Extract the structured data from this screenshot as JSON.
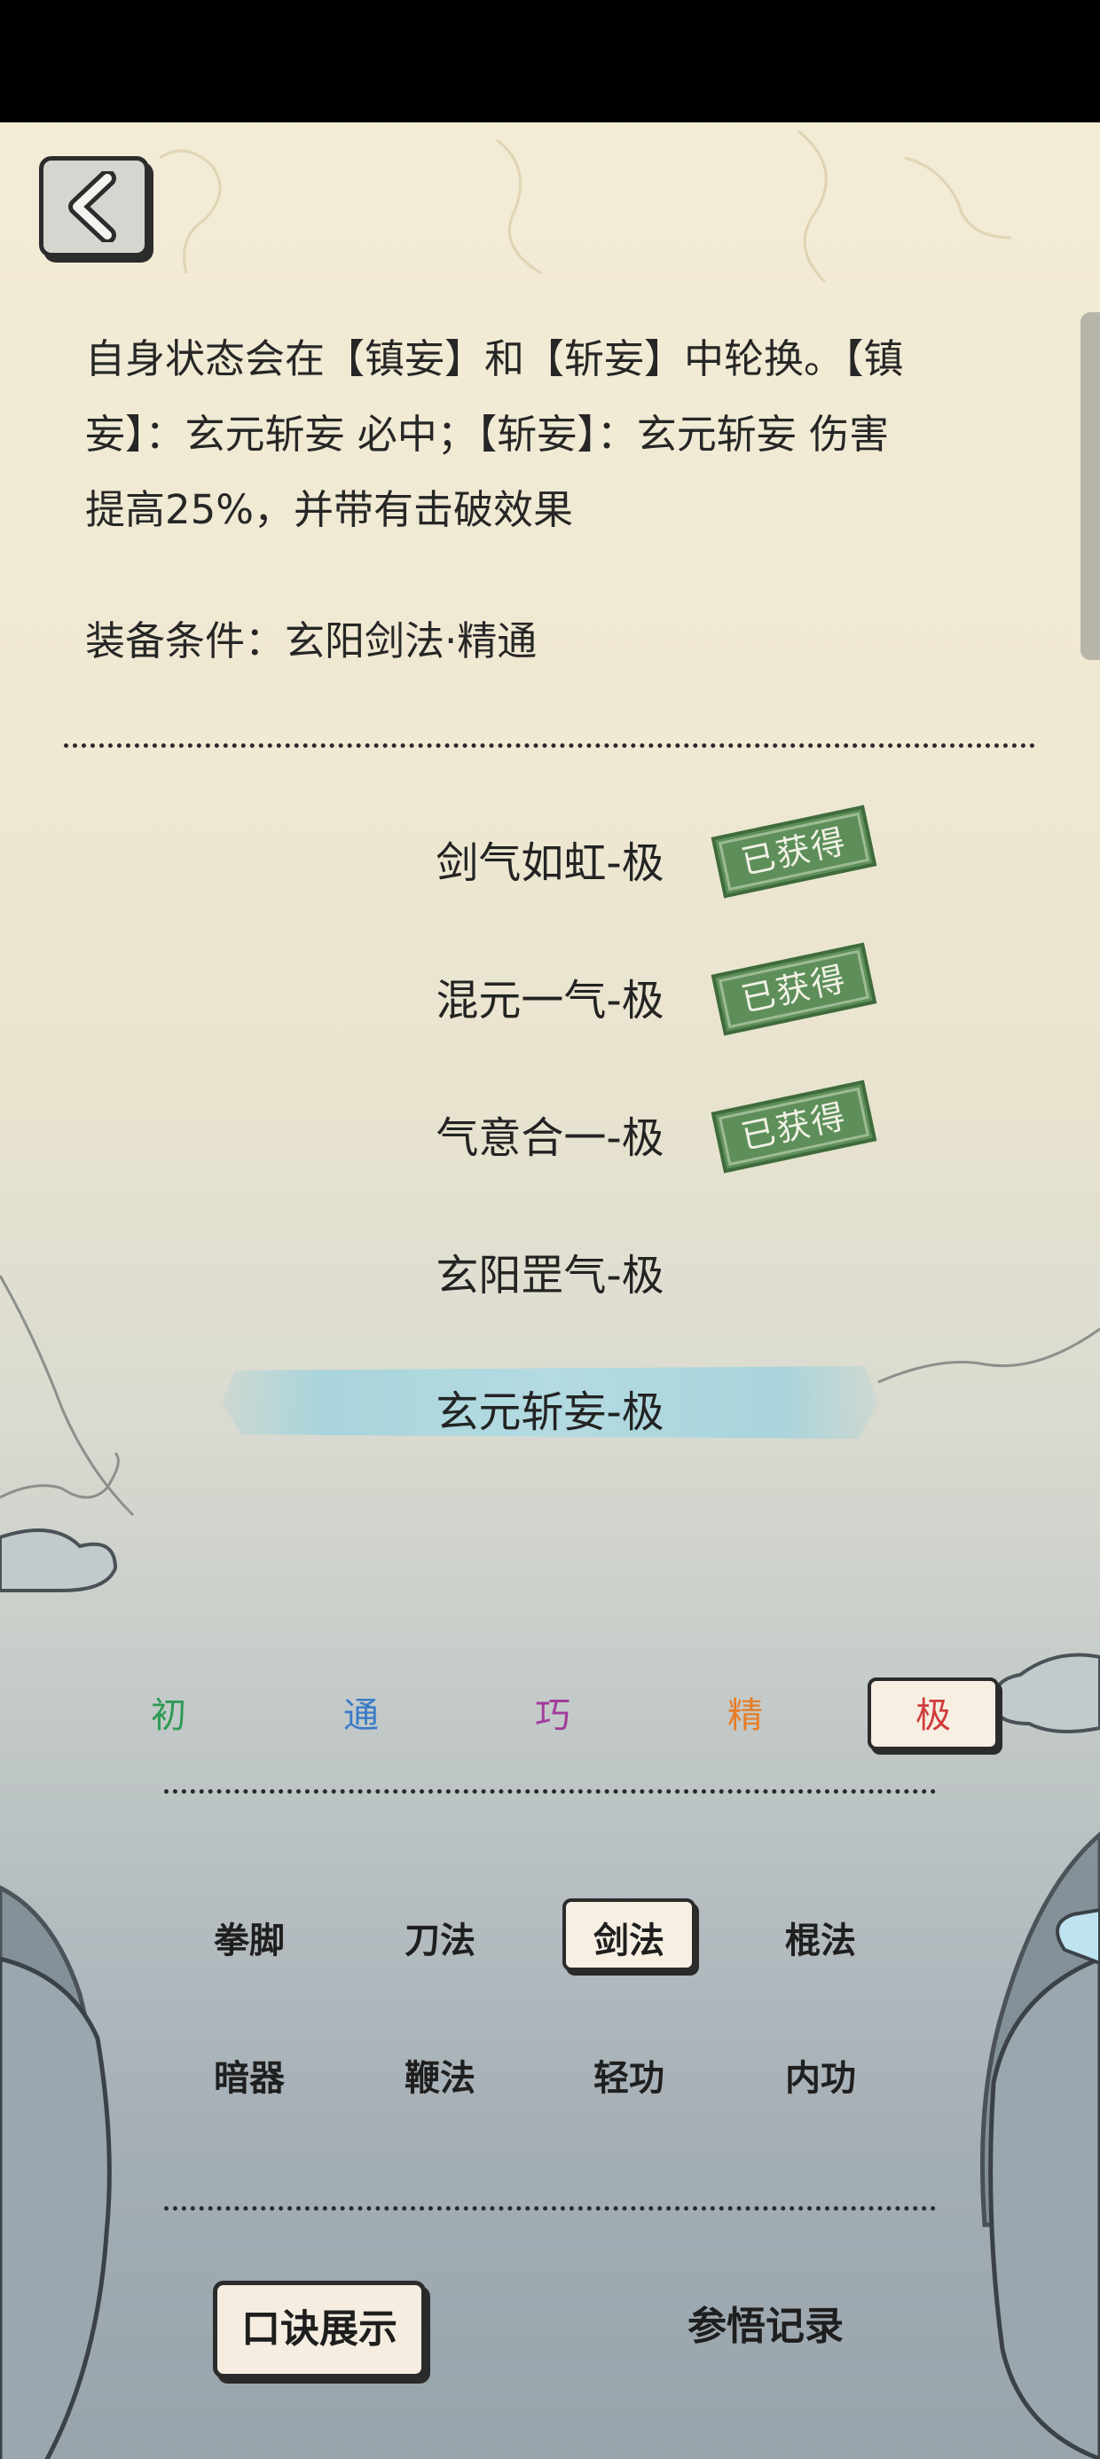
{
  "header": {
    "back_icon": "chevron-left-icon"
  },
  "skill_detail": {
    "description_line1": "自身状态会在【镇妄】和【斩妄】中轮换。【镇",
    "description_line2": "妄】：玄元斩妄 必中；【斩妄】：玄元斩妄 伤害",
    "description_line3": "提高25%，并带有击破效果",
    "equip_condition": "装备条件：玄阳剑法·精通"
  },
  "skill_list": [
    {
      "name": "剑气如虹-极",
      "badge": "已获得"
    },
    {
      "name": "混元一气-极",
      "badge": "已获得"
    },
    {
      "name": "气意合一-极",
      "badge": "已获得"
    },
    {
      "name": "玄阳罡气-极",
      "badge": ""
    },
    {
      "name": "玄元斩妄-极",
      "badge": "",
      "selected": true
    }
  ],
  "tiers": [
    {
      "label": "初",
      "color": "#2f9a55"
    },
    {
      "label": "通",
      "color": "#3a7bc8"
    },
    {
      "label": "巧",
      "color": "#a23c9c"
    },
    {
      "label": "精",
      "color": "#e87d26"
    },
    {
      "label": "极",
      "color": "#d23b3b",
      "selected": true
    }
  ],
  "categories": [
    {
      "label": "拳脚"
    },
    {
      "label": "刀法"
    },
    {
      "label": "剑法",
      "selected": true
    },
    {
      "label": "棍法"
    },
    {
      "label": "暗器"
    },
    {
      "label": "鞭法"
    },
    {
      "label": "轻功"
    },
    {
      "label": "内功"
    }
  ],
  "footer": {
    "show_button": "口诀展示",
    "record_button": "参悟记录"
  }
}
